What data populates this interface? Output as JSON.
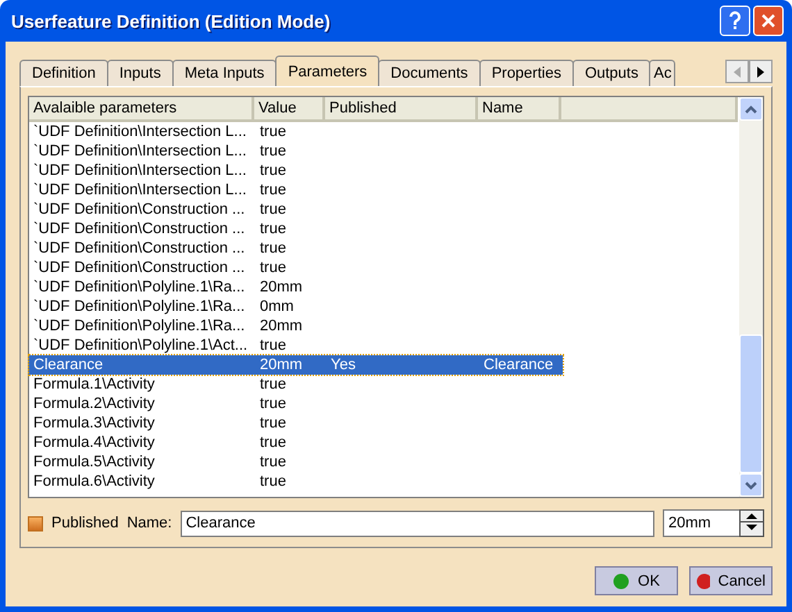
{
  "window": {
    "title": "Userfeature Definition (Edition Mode)"
  },
  "tabs": [
    {
      "label": "Definition",
      "selected": false
    },
    {
      "label": "Inputs",
      "selected": false
    },
    {
      "label": "Meta Inputs",
      "selected": false
    },
    {
      "label": "Parameters",
      "selected": true
    },
    {
      "label": "Documents",
      "selected": false
    },
    {
      "label": "Properties",
      "selected": false
    },
    {
      "label": "Outputs",
      "selected": false
    },
    {
      "label": "Ac",
      "selected": false
    }
  ],
  "table": {
    "columns": [
      "Avalaible parameters",
      "Value",
      "Published",
      "Name"
    ],
    "rows": [
      {
        "parameter": "`UDF Definition\\Intersection L...",
        "value": "true",
        "selected": false
      },
      {
        "parameter": "`UDF Definition\\Intersection L...",
        "value": "true",
        "selected": false
      },
      {
        "parameter": "`UDF Definition\\Intersection L...",
        "value": "true",
        "selected": false
      },
      {
        "parameter": "`UDF Definition\\Intersection L...",
        "value": "true",
        "selected": false
      },
      {
        "parameter": "`UDF Definition\\Construction ...",
        "value": "true",
        "selected": false
      },
      {
        "parameter": "`UDF Definition\\Construction ...",
        "value": "true",
        "selected": false
      },
      {
        "parameter": "`UDF Definition\\Construction ...",
        "value": "true",
        "selected": false
      },
      {
        "parameter": "`UDF Definition\\Construction ...",
        "value": "true",
        "selected": false
      },
      {
        "parameter": "`UDF Definition\\Polyline.1\\Ra...",
        "value": "20mm",
        "selected": false
      },
      {
        "parameter": "`UDF Definition\\Polyline.1\\Ra...",
        "value": "0mm",
        "selected": false
      },
      {
        "parameter": "`UDF Definition\\Polyline.1\\Ra...",
        "value": "20mm",
        "selected": false
      },
      {
        "parameter": "`UDF Definition\\Polyline.1\\Act...",
        "value": "true",
        "selected": false
      },
      {
        "parameter": "Clearance",
        "value": "20mm",
        "published": "Yes",
        "name": "Clearance",
        "selected": true
      },
      {
        "parameter": "Formula.1\\Activity",
        "value": "true",
        "selected": false
      },
      {
        "parameter": "Formula.2\\Activity",
        "value": "true",
        "selected": false
      },
      {
        "parameter": "Formula.3\\Activity",
        "value": "true",
        "selected": false
      },
      {
        "parameter": "Formula.4\\Activity",
        "value": "true",
        "selected": false
      },
      {
        "parameter": "Formula.5\\Activity",
        "value": "true",
        "selected": false
      },
      {
        "parameter": "Formula.6\\Activity",
        "value": "true",
        "selected": false
      }
    ]
  },
  "editor": {
    "published": {
      "label": "Published",
      "checked": true
    },
    "name_label": "Name:",
    "name_value": "Clearance",
    "value": "20mm"
  },
  "buttons": [
    {
      "label": "OK",
      "kind": "ok"
    },
    {
      "label": "Cancel",
      "kind": "cancel"
    }
  ]
}
